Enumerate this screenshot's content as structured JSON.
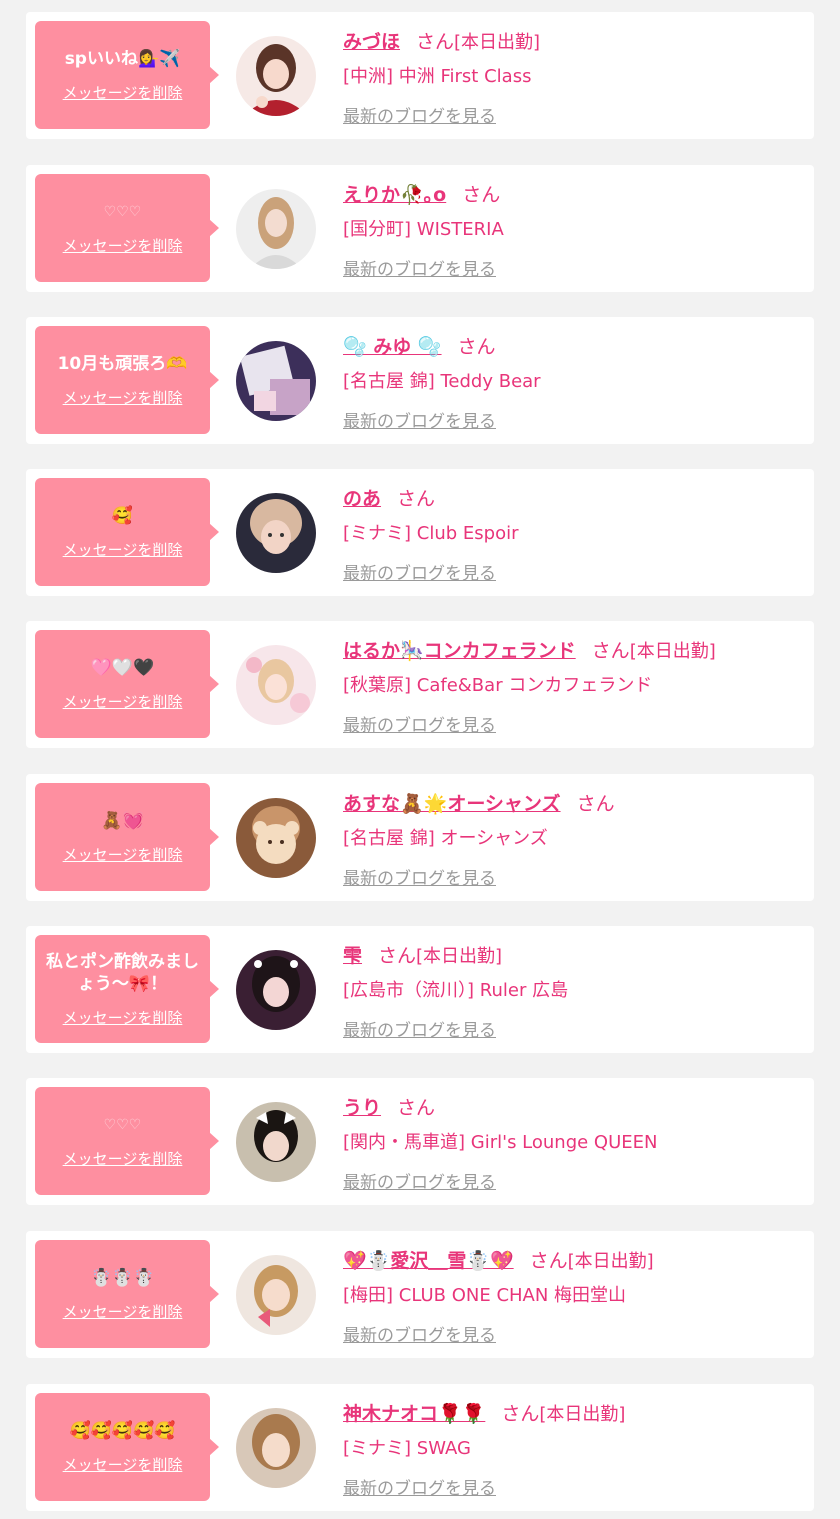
{
  "delete_label": "メッセージを削除",
  "blog_label": "最新のブログを見る",
  "san_label": "さん",
  "items": [
    {
      "message": "spいいね💁‍♀️✈️",
      "faint": false,
      "name": "みづほ",
      "shift": "[本日出勤]",
      "shop": "[中洲] 中洲 First Class"
    },
    {
      "message": "♡♡♡",
      "faint": true,
      "name": "えりか🥀｡o",
      "shift": "",
      "shop": "[国分町] WISTERIA"
    },
    {
      "message": "10月も頑張ろ🫶",
      "faint": false,
      "name": "🫧 みゆ 🫧",
      "shift": "",
      "shop": "[名古屋 錦] Teddy Bear"
    },
    {
      "message": "🥰",
      "faint": false,
      "name": "のあ",
      "shift": "",
      "shop": "[ミナミ] Club Espoir"
    },
    {
      "message": "🩷🤍🖤",
      "faint": false,
      "name": "はるか🎠コンカフェランド",
      "shift": "[本日出勤]",
      "shop": "[秋葉原] Cafe&Bar コンカフェランド"
    },
    {
      "message": "🧸💓",
      "faint": false,
      "name": "あすな🧸🌟オーシャンズ",
      "shift": "",
      "shop": "[名古屋 錦] オーシャンズ"
    },
    {
      "message": "私とポン酢飲みましょう〜🎀！",
      "faint": false,
      "name": "雫",
      "shift": "[本日出勤]",
      "shop": "[広島市（流川）] Ruler 広島"
    },
    {
      "message": "♡♡♡",
      "faint": true,
      "name": "うり",
      "shift": "",
      "shop": "[関内・馬車道] Girl's Lounge QUEEN"
    },
    {
      "message": "☃️☃️☃️",
      "faint": false,
      "name": "💖☃️愛沢＿雪☃️💖",
      "shift": "[本日出勤]",
      "shop": "[梅田] CLUB ONE CHAN 梅田堂山"
    },
    {
      "message": "🥰🥰🥰🥰🥰",
      "faint": false,
      "name": "神木ナオコ🌹🌹",
      "shift": "[本日出勤]",
      "shop": "[ミナミ] SWAG"
    }
  ],
  "colors": {
    "accent": "#e8357a",
    "bubble": "#fe8fa0",
    "background": "#f2f2f2"
  }
}
